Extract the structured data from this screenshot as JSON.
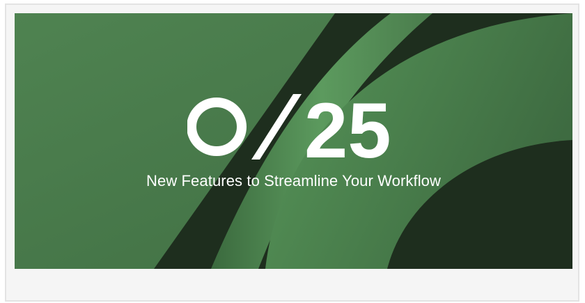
{
  "banner": {
    "logo_text": "25",
    "tagline": "New Features to Streamline Your Workflow"
  },
  "colors": {
    "base_green": "#4a7c4c",
    "light_green": "#5c9a5e",
    "dark_green": "#1e2e1e",
    "card_bg": "#f5f5f5",
    "card_border": "#e3e3e3",
    "text": "#ffffff"
  },
  "icons": {
    "logo_ring": "ring-icon",
    "logo_slash": "slash-icon"
  }
}
